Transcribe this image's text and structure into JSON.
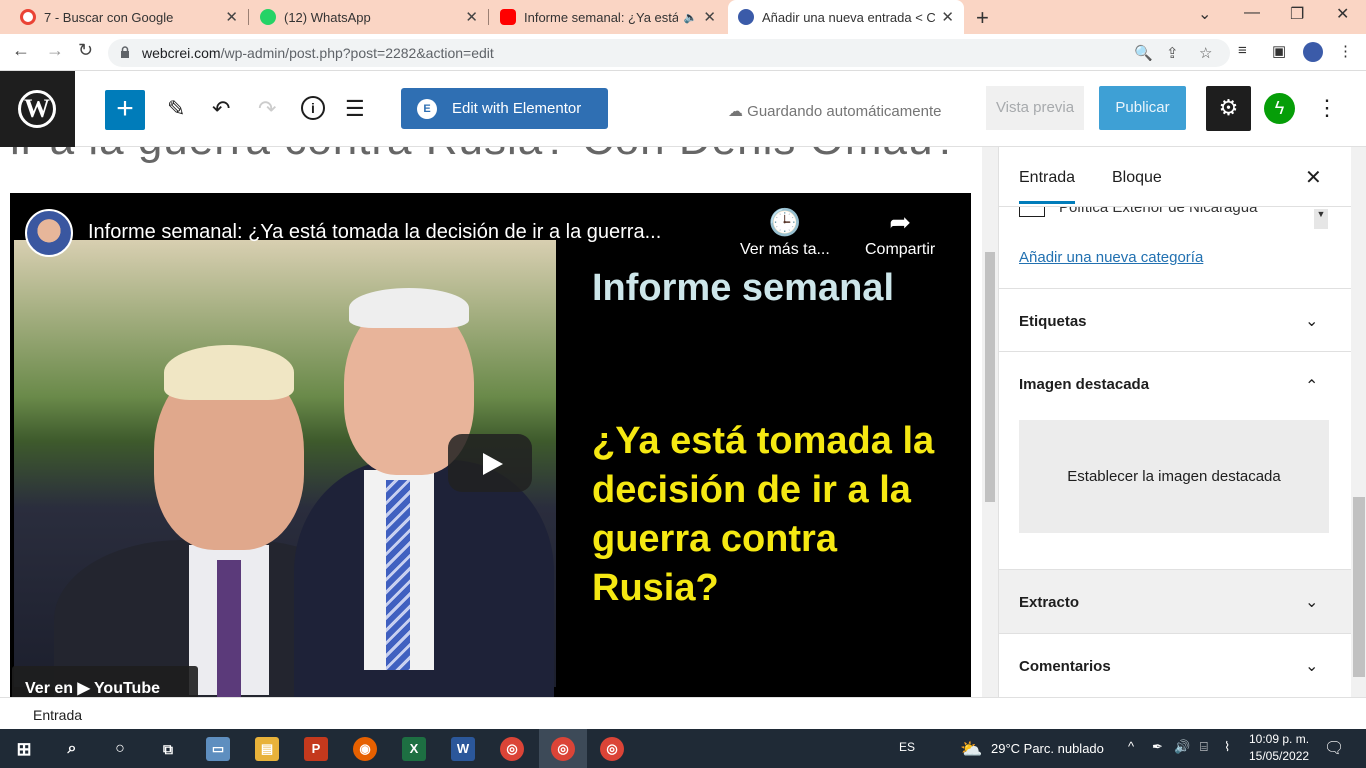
{
  "browser": {
    "tabs": [
      {
        "title": "7 - Buscar con Google",
        "icon": "google-icon",
        "color": "#ea4335"
      },
      {
        "title": "(12) WhatsApp",
        "icon": "whatsapp-icon",
        "color": "#25d366"
      },
      {
        "title": "Informe semanal: ¿Ya está to",
        "icon": "youtube-icon",
        "color": "#ff0000"
      },
      {
        "title": "Añadir una nueva entrada < CRE",
        "icon": "site-icon",
        "color": "#3b5ba9"
      }
    ],
    "url_host": "webcrei.com",
    "url_path": "/wp-admin/post.php?post=2282&action=edit"
  },
  "toolbar": {
    "elementor_label": "Edit with Elementor",
    "saving_label": "Guardando automáticamente",
    "preview_label": "Vista previa",
    "publish_label": "Publicar"
  },
  "editor": {
    "title_fragment": "ir a la guerra contra Rusia? Con Denis Omaü?",
    "video": {
      "title": "Informe semanal: ¿Ya está tomada la decisión de ir a la guerra...",
      "watch_later": "Ver más ta...",
      "share": "Compartir",
      "heading": "Informe semanal",
      "question": "¿Ya está tomada la decisión de ir a la guerra contra Rusia?",
      "watch_on": "Ver en  ▶ YouTube"
    }
  },
  "sidebar": {
    "tabs": [
      "Entrada",
      "Bloque"
    ],
    "category_item": "Política Exterior de Nicaragua",
    "add_category": "Añadir una nueva categoría",
    "panels": {
      "tags": "Etiquetas",
      "featured": "Imagen destacada",
      "featured_button": "Establecer la imagen destacada",
      "excerpt": "Extracto",
      "comments": "Comentarios"
    }
  },
  "footer": {
    "breadcrumb": "Entrada"
  },
  "taskbar": {
    "lang": "ES",
    "weather": "29°C  Parc. nublado",
    "time": "10:09 p. m.",
    "date": "15/05/2022"
  }
}
